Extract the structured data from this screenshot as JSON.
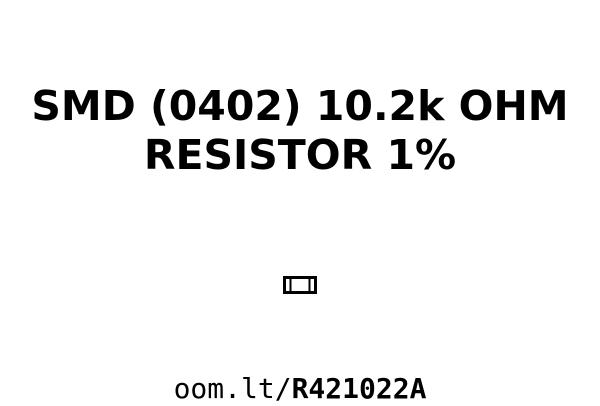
{
  "label": {
    "title_line1": "SMD (0402) 10.2k OHM",
    "title_line2": "RESISTOR 1%",
    "url_prefix": "oom.lt/",
    "url_code": "R421022A"
  },
  "icons": {
    "component": "smd-resistor-icon"
  },
  "colors": {
    "background": "#ffffff",
    "text": "#000000"
  }
}
